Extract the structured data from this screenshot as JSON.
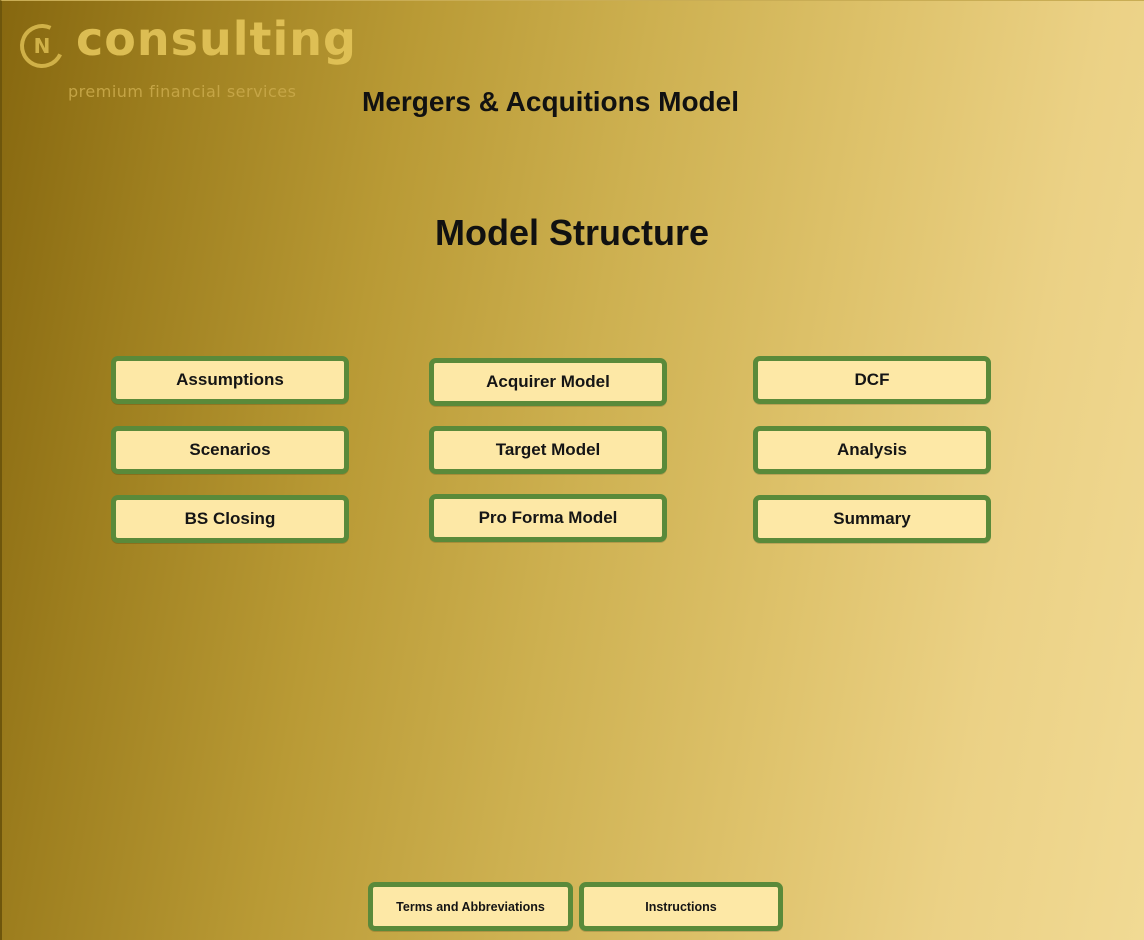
{
  "logo": {
    "mark": "N",
    "word": "consulting",
    "tagline": "premium financial services"
  },
  "header": {
    "title": "Mergers & Acquitions Model"
  },
  "main": {
    "section_title": "Model Structure",
    "nav_columns": [
      {
        "buttons": [
          {
            "label": "Assumptions"
          },
          {
            "label": "Scenarios"
          },
          {
            "label": "BS Closing"
          }
        ]
      },
      {
        "buttons": [
          {
            "label": "Acquirer Model"
          },
          {
            "label": "Target Model"
          },
          {
            "label": "Pro Forma Model"
          }
        ]
      },
      {
        "buttons": [
          {
            "label": "DCF"
          },
          {
            "label": "Analysis"
          },
          {
            "label": "Summary"
          }
        ]
      }
    ]
  },
  "footer": {
    "buttons": [
      {
        "label": "Terms and Abbreviations"
      },
      {
        "label": "Instructions"
      }
    ]
  },
  "colors": {
    "button_fill": "#fde8a6",
    "button_border": "#5a8a3a",
    "background_dark": "#86670f",
    "background_light": "#f1da94"
  }
}
